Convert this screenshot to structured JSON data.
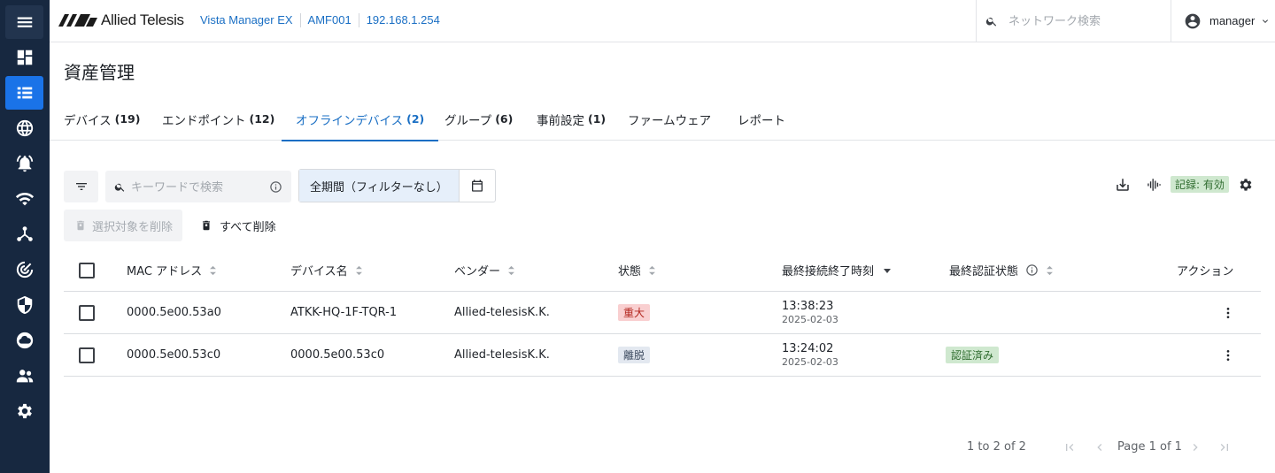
{
  "header": {
    "logo_text": "Allied Telesis",
    "breadcrumbs": [
      "Vista Manager EX",
      "AMF001",
      "192.168.1.254"
    ],
    "search_placeholder": "ネットワーク検索",
    "user": "manager"
  },
  "sidebar": {
    "icons": [
      "menu-icon",
      "dashboard-icon",
      "list-icon",
      "globe-icon",
      "alarm-icon",
      "wifi-icon",
      "topology-icon",
      "radar-icon",
      "shield-icon",
      "cloud-icon",
      "users-icon",
      "gear-icon"
    ],
    "active_index": 2
  },
  "page": {
    "title": "資産管理"
  },
  "tabs": [
    {
      "label": "デバイス",
      "count": "(19)"
    },
    {
      "label": "エンドポイント",
      "count": "(12)"
    },
    {
      "label": "オフラインデバイス",
      "count": "(2)"
    },
    {
      "label": "グループ",
      "count": "(6)"
    },
    {
      "label": "事前設定",
      "count": "(1)"
    },
    {
      "label": "ファームウェア",
      "count": ""
    },
    {
      "label": "レポート",
      "count": ""
    }
  ],
  "active_tab": 2,
  "toolbar": {
    "keyword_placeholder": "キーワードで検索",
    "period_label": "全期間（フィルターなし）",
    "record_badge": "記録: 有効",
    "delete_selected": "選択対象を削除",
    "delete_all": "すべて削除"
  },
  "table": {
    "headers": {
      "mac": "MAC アドレス",
      "name": "デバイス名",
      "vendor": "ベンダー",
      "state": "状態",
      "last_conn": "最終接続終了時刻",
      "auth": "最終認証状態",
      "action": "アクション"
    },
    "rows": [
      {
        "mac": "0000.5e00.53a0",
        "name": "ATKK-HQ-1F-TQR-1",
        "vendor": "Allied-telesisK.K.",
        "state": "重大",
        "time": "13:38:23",
        "date": "2025-02-03",
        "auth": ""
      },
      {
        "mac": "0000.5e00.53c0",
        "name": "0000.5e00.53c0",
        "vendor": "Allied-telesisK.K.",
        "state": "離脱",
        "time": "13:24:02",
        "date": "2025-02-03",
        "auth": "認証済み"
      }
    ]
  },
  "pagination": {
    "range": "1 to 2 of 2",
    "page": "Page 1 of 1"
  },
  "colors": {
    "sidebar_bg": "#172840",
    "accent": "#1a73e8",
    "critical_bg": "#f9cfd0",
    "critical_fg": "#b3261e",
    "left_bg": "#e3e8f0",
    "left_fg": "#3c4a5f",
    "auth_bg": "#cfe8cf",
    "auth_fg": "#2e6b2e"
  }
}
